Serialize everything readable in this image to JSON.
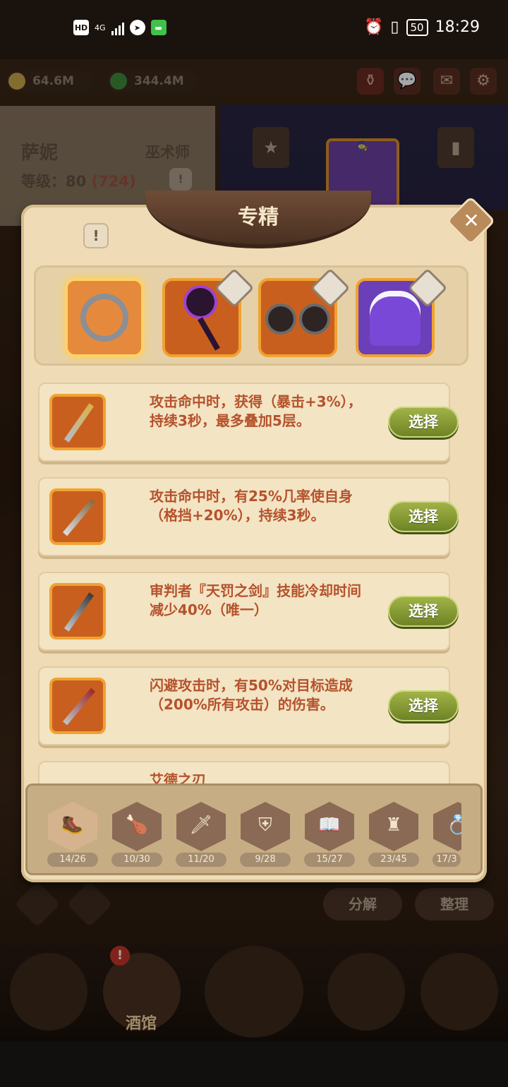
{
  "status_bar": {
    "hd_label": "HD",
    "network_label": "4G",
    "battery": "50",
    "time": "18:29"
  },
  "resources": {
    "gold": "64.6M",
    "gem": "344.4M"
  },
  "hero": {
    "name": "萨妮",
    "class": "巫术师",
    "level_label": "等级：80",
    "level_extra": "(724)"
  },
  "modal": {
    "title": "专精",
    "close_icon": "close-icon",
    "options": [
      {
        "text": "攻击命中时，获得（暴击+3%），持续3秒，最多叠加5层。",
        "button": "选择",
        "icon": "golden-sword-icon"
      },
      {
        "text": "攻击命中时，有25%几率使自身（格挡+20%），持续3秒。",
        "button": "选择",
        "icon": "curved-dagger-icon"
      },
      {
        "text": "审判者『天罚之剑』技能冷却时间减少40%（唯一）",
        "button": "选择",
        "icon": "hooked-sword-icon"
      },
      {
        "text": "闪避攻击时，有50%对目标造成（200%所有攻击）的伤害。",
        "button": "选择",
        "icon": "dark-dagger-icon"
      },
      {
        "text": "艾德之刃",
        "button": "",
        "icon": "sword-icon"
      }
    ],
    "equipment": [
      {
        "name": "ring-icon",
        "selected": true
      },
      {
        "name": "staff-icon",
        "selected": false
      },
      {
        "name": "goggles-icon",
        "selected": false
      },
      {
        "name": "cloak-icon",
        "selected": false
      }
    ],
    "categories": [
      {
        "icon": "boot-icon",
        "glyph": "🥾",
        "count": "14/26"
      },
      {
        "icon": "club-icon",
        "glyph": "🍗",
        "count": "10/30"
      },
      {
        "icon": "sword-icon",
        "glyph": "🗡",
        "count": "11/20"
      },
      {
        "icon": "shield-icon",
        "glyph": "⛨",
        "count": "9/28"
      },
      {
        "icon": "book-icon",
        "glyph": "📖",
        "count": "15/27"
      },
      {
        "icon": "armor-icon",
        "glyph": "♜",
        "count": "23/45"
      },
      {
        "icon": "ring-icon",
        "glyph": "💍",
        "count": "17/3"
      }
    ]
  },
  "bottom_actions": {
    "decompose": "分解",
    "organize": "整理"
  },
  "nav": {
    "tavern": "酒馆"
  },
  "colors": {
    "modal_bg": "#efdcb6",
    "accent_text": "#b5522d",
    "select_button": "#8fa33a"
  }
}
